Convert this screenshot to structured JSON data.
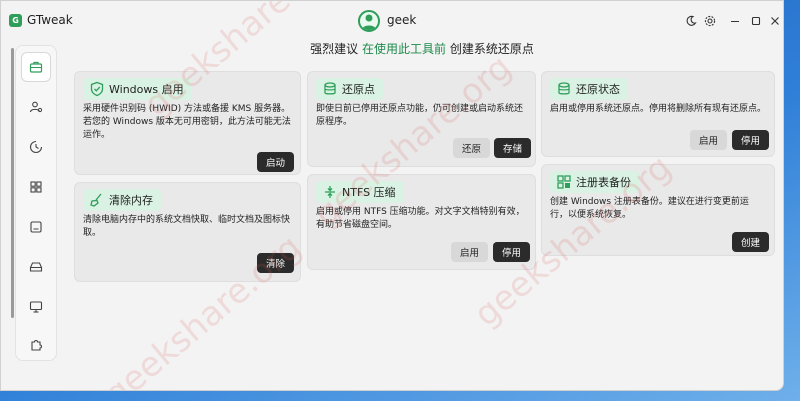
{
  "app": {
    "title": "GTweak",
    "user": "geek"
  },
  "banner": {
    "prefix": "强烈建议",
    "highlight": "在使用此工具前",
    "suffix": "创建系统还原点"
  },
  "sidebar": {
    "items": [
      {
        "icon": "toolbox-icon"
      },
      {
        "icon": "user-settings-icon"
      },
      {
        "icon": "privacy-icon"
      },
      {
        "icon": "apps-icon"
      },
      {
        "icon": "services-icon"
      },
      {
        "icon": "drive-icon"
      },
      {
        "icon": "monitor-icon"
      },
      {
        "icon": "puzzle-icon"
      }
    ]
  },
  "cards": {
    "windows_activation": {
      "title": "Windows 启用",
      "desc": "采用硬件识别码 (HWID) 方法或备援 KMS 服务器。若您的 Windows 版本无可用密钥，此方法可能无法运作。",
      "btn": "启动"
    },
    "restore_point": {
      "title": "还原点",
      "desc": "即使日前已停用还原点功能，仍可创建或启动系统还原程序。",
      "btn_restore": "还原",
      "btn_create": "存储"
    },
    "restore_status": {
      "title": "还原状态",
      "desc": "启用或停用系统还原点。停用将删除所有现有还原点。",
      "btn_enable": "启用",
      "btn_disable": "停用"
    },
    "clear_memory": {
      "title": "清除内存",
      "desc": "清除电脑内存中的系统文档快取、临时文档及图标快取。",
      "btn": "清除"
    },
    "ntfs": {
      "title": "NTFS 压缩",
      "desc": "启用或停用 NTFS 压缩功能。对文字文档特别有效，有助节省磁盘空间。",
      "btn_enable": "启用",
      "btn_disable": "停用"
    },
    "registry_backup": {
      "title": "注册表备份",
      "desc": "创建 Windows 注册表备份。建议在进行变更前运行，以便系统恢复。",
      "btn": "创建"
    }
  },
  "watermark": "geekshare.org",
  "colors": {
    "accent": "#2e9e5a",
    "card_head": "#daf2e3",
    "dark_btn": "#2b2b2b"
  }
}
